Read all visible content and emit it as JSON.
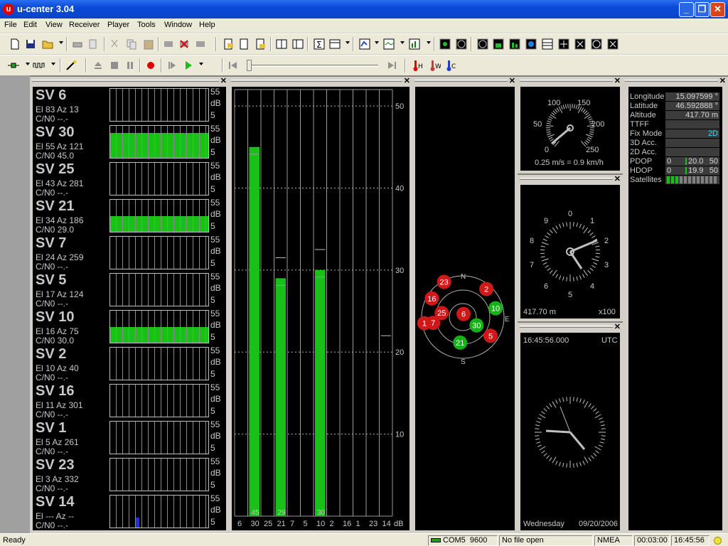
{
  "window": {
    "title": "u-center 3.04"
  },
  "menu": [
    "File",
    "Edit",
    "View",
    "Receiver",
    "Player",
    "Tools",
    "Window",
    "Help"
  ],
  "satellites": [
    {
      "name": "SV 6",
      "el_az": "El 83 Az 13",
      "cn0": "C/N0 --.-",
      "level": 0
    },
    {
      "name": "SV 30",
      "el_az": "El 55 Az 121",
      "cn0": "C/N0 45.0",
      "level": 0.78
    },
    {
      "name": "SV 25",
      "el_az": "El 43 Az 281",
      "cn0": "C/N0 --.-",
      "level": 0
    },
    {
      "name": "SV 21",
      "el_az": "El 34 Az 186",
      "cn0": "C/N0 29.0",
      "level": 0.48
    },
    {
      "name": "SV 7",
      "el_az": "El 24 Az 259",
      "cn0": "C/N0 --.-",
      "level": 0
    },
    {
      "name": "SV 5",
      "el_az": "El 17 Az 124",
      "cn0": "C/N0 --.-",
      "level": 0
    },
    {
      "name": "SV 10",
      "el_az": "El 16 Az 75",
      "cn0": "C/N0 30.0",
      "level": 0.5
    },
    {
      "name": "SV 2",
      "el_az": "El 10 Az 40",
      "cn0": "C/N0 --.-",
      "level": 0
    },
    {
      "name": "SV 16",
      "el_az": "El 11 Az 301",
      "cn0": "C/N0 --.-",
      "level": 0
    },
    {
      "name": "SV 1",
      "el_az": "El 5 Az 261",
      "cn0": "C/N0 --.-",
      "level": 0
    },
    {
      "name": "SV 23",
      "el_az": "El 3 Az 332",
      "cn0": "C/N0 --.-",
      "level": 0
    },
    {
      "name": "SV 14",
      "el_az": "El --- Az --",
      "cn0": "C/N0 --.-",
      "level": 0
    }
  ],
  "sv_scale": {
    "top": "55",
    "unit": "dB",
    "bottom": "5"
  },
  "chart_data": {
    "type": "bar",
    "categories": [
      "6",
      "30",
      "25",
      "21",
      "7",
      "5",
      "10",
      "2",
      "16",
      "1",
      "23",
      "14"
    ],
    "values": [
      0,
      45,
      0,
      29,
      0,
      0,
      30,
      0,
      0,
      0,
      0,
      0
    ],
    "value_labels": [
      "",
      "45",
      "",
      "29",
      "",
      "",
      "30",
      "",
      "",
      "",
      "",
      ""
    ],
    "xlabel": "dB",
    "yticks": [
      "50",
      "40",
      "30",
      "20",
      "10"
    ],
    "ylim": [
      0,
      52
    ]
  },
  "skyview": {
    "compass": {
      "north": "N",
      "east": "E",
      "south": "S"
    },
    "tracked": [
      "30",
      "21",
      "10"
    ],
    "untracked": [
      "23",
      "2",
      "16",
      "25",
      "6",
      "1",
      "7",
      "5"
    ]
  },
  "speed": {
    "labels": [
      "0",
      "50",
      "100",
      "150",
      "200",
      "250"
    ],
    "readout": "0.25 m/s = 0.9 km/h"
  },
  "altitude": {
    "labels": [
      "0",
      "1",
      "2",
      "3",
      "4",
      "5",
      "6",
      "7",
      "8",
      "9"
    ],
    "readout": "417.70 m",
    "scale": "x100"
  },
  "clock": {
    "time": "16:45:56.000",
    "zone": "UTC",
    "day": "Wednesday",
    "date": "09/20/2006"
  },
  "info": {
    "longitude_label": "Longitude",
    "longitude": "15.097599 °",
    "latitude_label": "Latitude",
    "latitude": "46.592888 °",
    "altitude_label": "Altitude",
    "altitude": "417.70 m",
    "ttff_label": "TTFF",
    "ttff": "",
    "fixmode_label": "Fix Mode",
    "fixmode": "2D",
    "acc3d_label": "3D Acc.",
    "acc3d": "",
    "acc2d_label": "2D Acc.",
    "acc2d": "",
    "pdop_label": "PDOP",
    "pdop_min": "0",
    "pdop": "20.0",
    "pdop_max": "50",
    "hdop_label": "HDOP",
    "hdop_min": "0",
    "hdop": "19.9",
    "hdop_max": "50",
    "satellites_label": "Satellites"
  },
  "status": {
    "ready": "Ready",
    "port": "COM5",
    "baud": "9600",
    "file": "No file open",
    "protocol": "NMEA",
    "elapsed": "00:03:00",
    "clock": "16:45:56"
  },
  "colors": {
    "accent": "#18c018",
    "tracked": "#18b018",
    "untracked": "#d01818"
  }
}
